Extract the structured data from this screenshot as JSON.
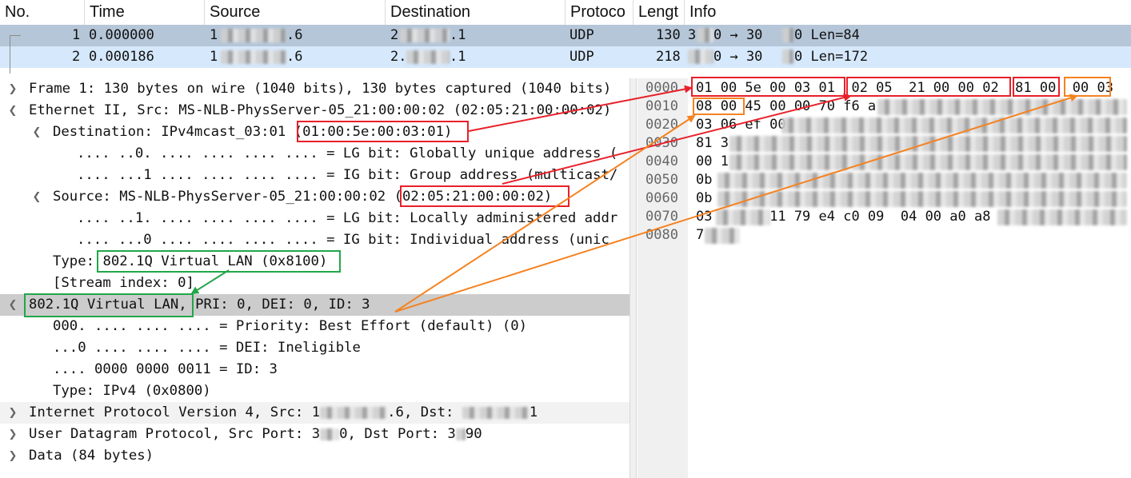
{
  "packet_list": {
    "columns": [
      "No.",
      "Time",
      "Source",
      "Destination",
      "Protoco",
      "Lengt",
      "Info"
    ],
    "rows": [
      {
        "no": "1",
        "time": "0.000000",
        "source": "1",
        "source_tail": ".6",
        "destination": "2",
        "destination_tail": ".1",
        "protocol": "UDP",
        "length": "130",
        "info_a": "3",
        "info_b": "0 → 30",
        "info_c": "0 Len=84"
      },
      {
        "no": "2",
        "time": "0.000186",
        "source": "1",
        "source_tail": ".6",
        "destination": "2.",
        "destination_tail": ".1",
        "protocol": "UDP",
        "length": "218",
        "info_a": "",
        "info_b": "0 → 30",
        "info_c": "0 Len=172"
      }
    ]
  },
  "details": {
    "frame": "Frame 1: 130 bytes on wire (1040 bits), 130 bytes captured (1040 bits)",
    "ethernet": "Ethernet II, Src: MS-NLB-PhysServer-05_21:00:00:02 (02:05:21:00:00:02)",
    "eth_dst": "Destination: IPv4mcast_03:01 ",
    "eth_dst_addr": "(01:00:5e:00:03:01)",
    "eth_dst_lg": ".... ..0. .... .... .... .... = LG bit: Globally unique address (",
    "eth_dst_ig": ".... ...1 .... .... .... .... = IG bit: Group address (multicast/",
    "eth_src": "Source: MS-NLB-PhysServer-05_21:00:00:02 ",
    "eth_src_addr": "(02:05:21:00:00:02)",
    "eth_src_lg": ".... ..1. .... .... .... .... = LG bit: Locally administered addr",
    "eth_src_ig": ".... ...0 .... .... .... .... = IG bit: Individual address (unic",
    "eth_type_label": "Type: ",
    "eth_type_value": "802.1Q Virtual LAN (0x8100)",
    "stream_index": "[Stream index: 0]",
    "vlan_title": "802.1Q Virtual LAN,",
    "vlan_rest": " PRI: 0, DEI: 0, ID: 3",
    "vlan_pri": "000. .... .... .... = Priority: Best Effort (default) (0)",
    "vlan_dei": "...0 .... .... .... = DEI: Ineligible",
    "vlan_id": ".... 0000 0000 0011 = ID: 3",
    "vlan_type": "Type: IPv4 (0x0800)",
    "ip_a": "Internet Protocol Version 4, Src: 1",
    "ip_b": ".6, Dst: ",
    "ip_c": "1",
    "udp_a": "User Datagram Protocol, Src Port: 3",
    "udp_b": "0, Dst Port: 3",
    "udp_c": "90",
    "data": "Data (84 bytes)"
  },
  "bytes": {
    "offsets": [
      "0000",
      "0010",
      "0020",
      "0030",
      "0040",
      "0050",
      "0060",
      "0070",
      "0080"
    ],
    "lines": [
      "01 00 5e 00 03 01  02 05  21 00 00 02  81 00  00 03",
      "08 00 45 00 00 70 f6 a",
      "03 06 ef 00",
      "81 3",
      "00 1",
      "0b",
      "0b",
      "03       11 79 e4 c0 09  04 00 a0 a8",
      "7"
    ]
  },
  "annotation_colors": {
    "red": "#e8202a",
    "green": "#22a64b",
    "orange": "#f58220"
  }
}
